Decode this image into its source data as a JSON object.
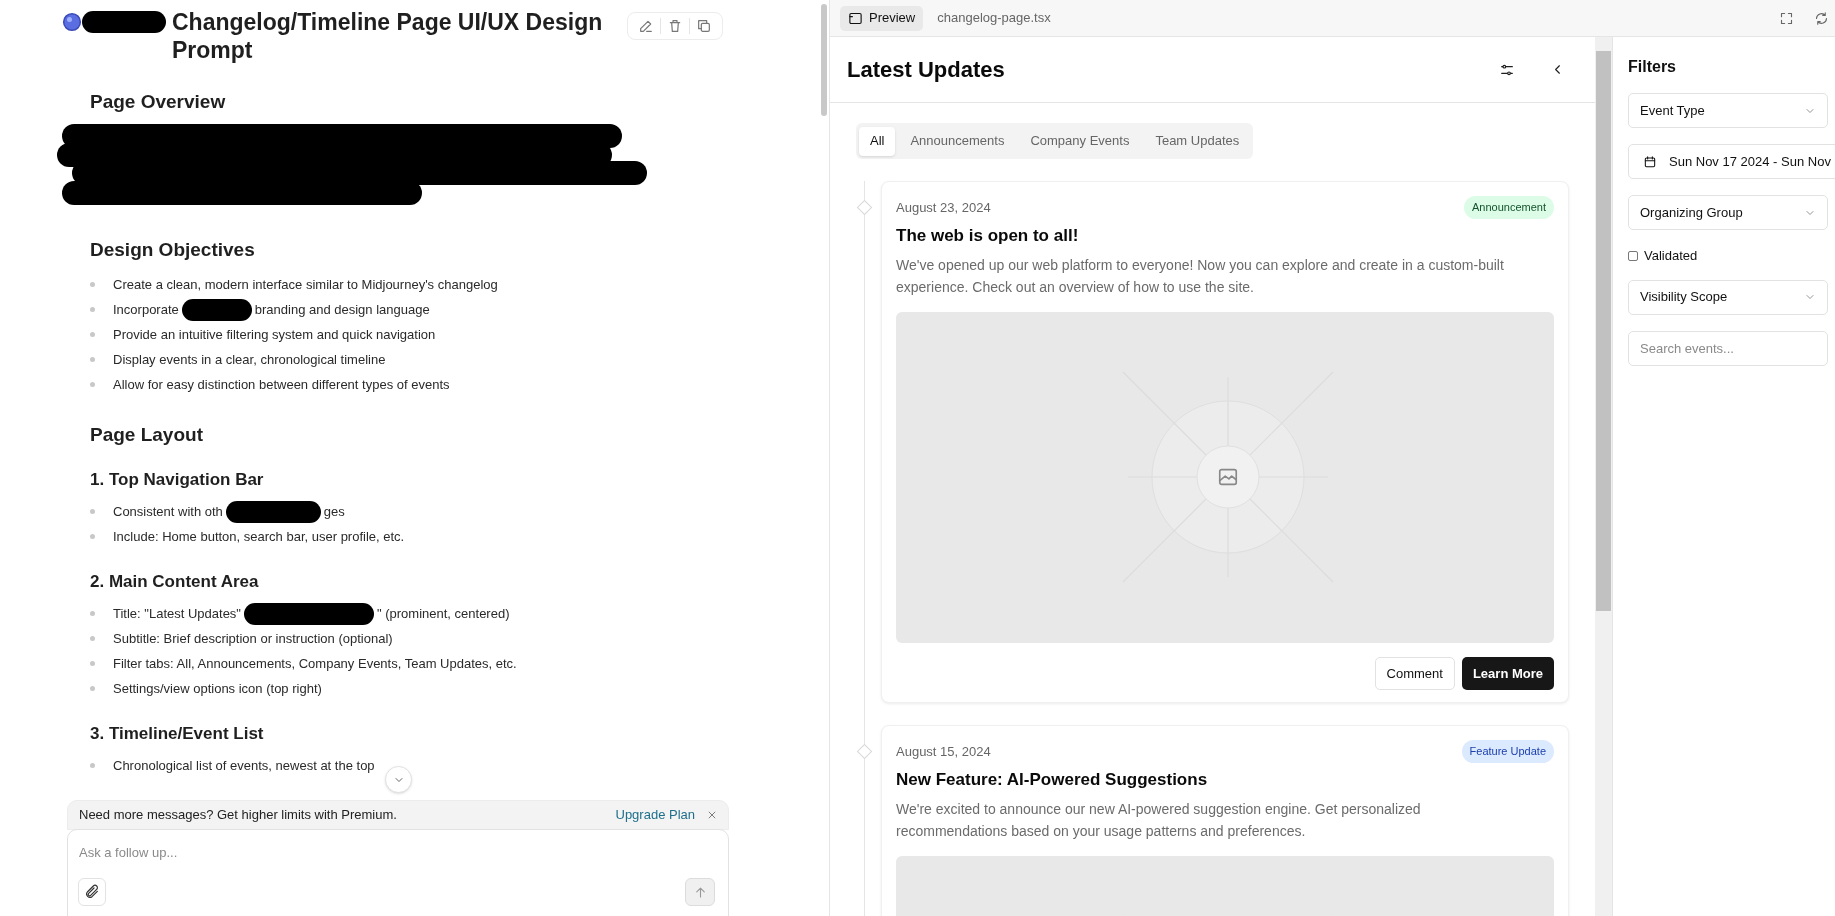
{
  "chat": {
    "title": {
      "redacted_prefix": true,
      "text": "Changelog/Timeline Page UI/UX Design Prompt"
    },
    "blocks": [
      {
        "kind": "h2",
        "text": "Page Overview"
      },
      {
        "kind": "redacted_paragraph"
      },
      {
        "kind": "h2",
        "text": "Design Objectives"
      },
      {
        "kind": "bullets",
        "items": [
          {
            "parts": [
              "Create a clean, modern interface similar to Midjourney's changelog"
            ]
          },
          {
            "parts": [
              "Incorporate",
              "branding and design language"
            ]
          },
          {
            "parts": [
              "Provide an intuitive filtering system and quick navigation"
            ]
          },
          {
            "parts": [
              "Display events in a clear, chronological timeline"
            ]
          },
          {
            "parts": [
              "Allow for easy distinction between different types of events"
            ]
          }
        ]
      },
      {
        "kind": "h2",
        "text": "Page Layout"
      },
      {
        "kind": "h3",
        "text": "1. Top Navigation Bar"
      },
      {
        "kind": "bullets",
        "items": [
          {
            "parts": [
              "Consistent with oth",
              "ges"
            ]
          },
          {
            "parts": [
              "Include: Home button, search bar, user profile, etc."
            ]
          }
        ]
      },
      {
        "kind": "h3",
        "text": "2. Main Content Area"
      },
      {
        "kind": "bullets",
        "items": [
          {
            "parts": [
              "Title: \"Latest Updates\"",
              "\" (prominent, centered)"
            ]
          },
          {
            "parts": [
              "Subtitle: Brief description or instruction (optional)"
            ]
          },
          {
            "parts": [
              "Filter tabs: All, Announcements, Company Events, Team Updates, etc."
            ]
          },
          {
            "parts": [
              "Settings/view options icon (top right)"
            ]
          }
        ]
      },
      {
        "kind": "h3",
        "text": "3. Timeline/Event List"
      },
      {
        "kind": "bullets",
        "items": [
          {
            "parts": [
              "Chronological list of events, newest at the top"
            ]
          }
        ]
      }
    ],
    "banner": {
      "text": "Need more messages? Get higher limits with Premium.",
      "link": "Upgrade Plan"
    },
    "input": {
      "placeholder": "Ask a follow up..."
    }
  },
  "preview": {
    "tabs": [
      {
        "label": "Preview",
        "selected": true
      },
      {
        "label": "changelog-page.tsx",
        "selected": false
      }
    ],
    "title": "Latest Updates",
    "filter_tabs": [
      {
        "label": "All",
        "selected": true
      },
      {
        "label": "Announcements",
        "selected": false
      },
      {
        "label": "Company Events",
        "selected": false
      },
      {
        "label": "Team Updates",
        "selected": false
      }
    ],
    "events": [
      {
        "date": "August 23, 2024",
        "badge": {
          "label": "Announcement",
          "kind": "announcement",
          "color": "#dcfce7"
        },
        "title": "The web is open to all!",
        "description": "We've opened up our web platform to everyone! Now you can explore and create in a custom-built experience. Check out an overview of how to use the site.",
        "actions": [
          "Comment",
          "Learn More"
        ]
      },
      {
        "date": "August 15, 2024",
        "badge": {
          "label": "Feature Update",
          "kind": "feature",
          "color": "#dbeafe"
        },
        "title": "New Feature: AI-Powered Suggestions",
        "description": "We're excited to announce our new AI-powered suggestion engine. Get personalized recommendations based on your usage patterns and preferences."
      }
    ]
  },
  "filters": {
    "title": "Filters",
    "controls": [
      {
        "kind": "select",
        "label": "Event Type"
      },
      {
        "kind": "date_range",
        "value": "Sun Nov 17 2024 - Sun Nov"
      },
      {
        "kind": "select",
        "label": "Organizing Group"
      },
      {
        "kind": "checkbox",
        "label": "Validated",
        "checked": false
      },
      {
        "kind": "select",
        "label": "Visibility Scope"
      },
      {
        "kind": "search",
        "placeholder": "Search events..."
      }
    ]
  }
}
